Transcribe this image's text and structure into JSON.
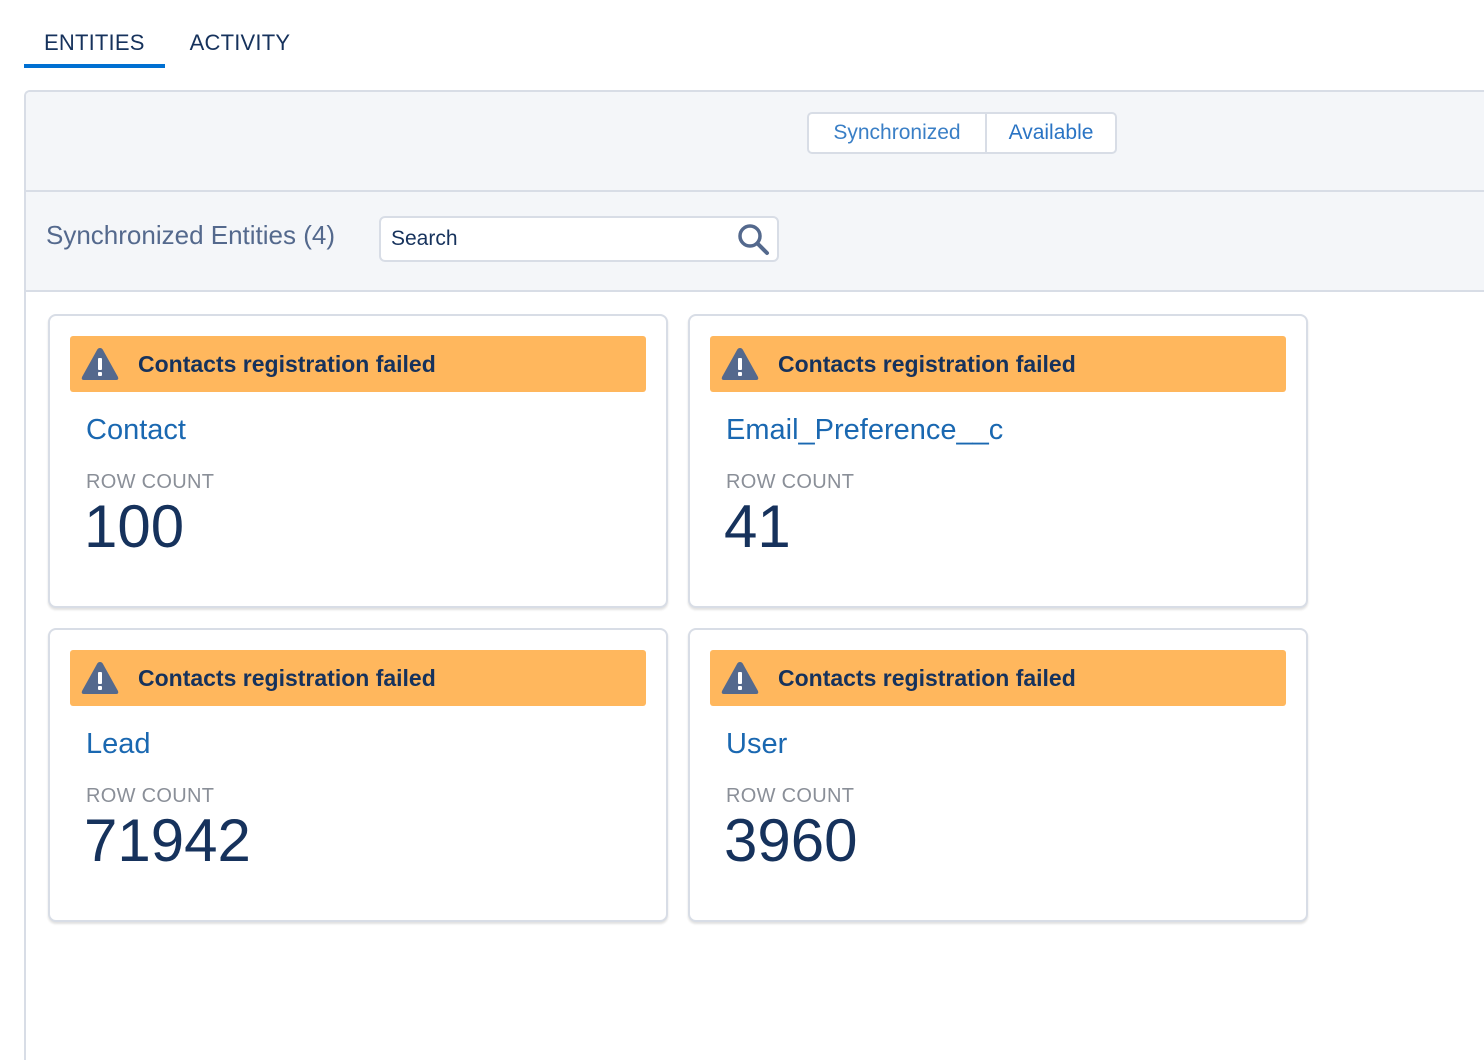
{
  "tabs": [
    {
      "label": "ENTITIES",
      "active": true
    },
    {
      "label": "ACTIVITY",
      "active": false
    }
  ],
  "toolbar": {
    "segments": [
      "Synchronized",
      "Available"
    ],
    "selected": "Synchronized"
  },
  "subbar": {
    "title": "Synchronized Entities (4)",
    "search": {
      "placeholder": "Search",
      "value": ""
    }
  },
  "colors": {
    "accent": "#0070d2",
    "warning": "#ffb75d",
    "text_dark": "#16325c",
    "link": "#1a68b1"
  },
  "cards": [
    {
      "alert": "Contacts registration failed",
      "name": "Contact",
      "row_label": "ROW COUNT",
      "row_count": "100"
    },
    {
      "alert": "Contacts registration failed",
      "name": "Email_Preference__c",
      "row_label": "ROW COUNT",
      "row_count": "41"
    },
    {
      "alert": "Contacts registration failed",
      "name": "Lead",
      "row_label": "ROW COUNT",
      "row_count": "71942"
    },
    {
      "alert": "Contacts registration failed",
      "name": "User",
      "row_label": "ROW COUNT",
      "row_count": "3960"
    }
  ],
  "icons": {
    "search": "search-icon",
    "warning": "warning-icon"
  }
}
